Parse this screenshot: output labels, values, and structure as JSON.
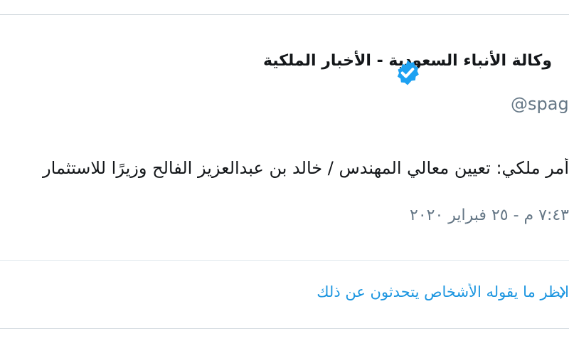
{
  "tweet": {
    "author_name": "وكالة الأنباء السعودية - الأخبار الملكية",
    "handle": "@spagov",
    "text": "أمر ملكي: تعيين معالي المهندس / خالد بن عبدالعزيز الفالح وزيرًا للاستثمار",
    "timestamp": "٧:٤٣ م - ٢٥ فبراير ٢٠٢٠",
    "talking_link": "انظر ما يقوله الأشخاص يتحدثون عن ذلك"
  },
  "colors": {
    "verified_badge": "#1da1f2",
    "link": "#1b95e0",
    "muted": "#657786",
    "border": "#d4dbe0"
  },
  "icons": {
    "verified": "verified-badge-icon",
    "chevron": "chevron-right-icon"
  }
}
